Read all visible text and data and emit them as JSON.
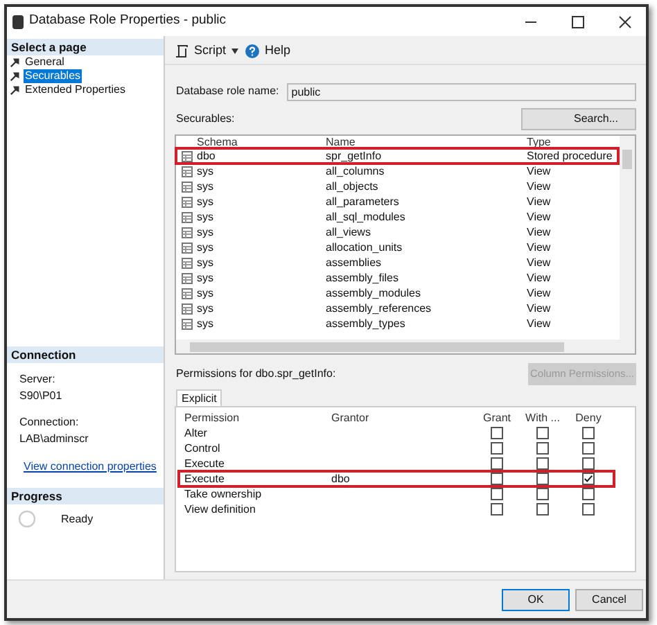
{
  "window": {
    "title": "Database Role Properties - public"
  },
  "select_page": {
    "title": "Select a page",
    "items": [
      {
        "label": "General",
        "selected": false
      },
      {
        "label": "Securables",
        "selected": true
      },
      {
        "label": "Extended Properties",
        "selected": false
      }
    ]
  },
  "toolbar": {
    "script": "Script",
    "help": "Help"
  },
  "role_name": {
    "label": "Database role name:",
    "value": "public"
  },
  "securables": {
    "label": "Securables:",
    "search": "Search...",
    "columns": [
      "Schema",
      "Name",
      "Type"
    ],
    "rows": [
      {
        "schema": "dbo",
        "name": "spr_getInfo",
        "type": "Stored procedure",
        "highlighted": true
      },
      {
        "schema": "sys",
        "name": "all_columns",
        "type": "View",
        "highlighted": false
      },
      {
        "schema": "sys",
        "name": "all_objects",
        "type": "View",
        "highlighted": false
      },
      {
        "schema": "sys",
        "name": "all_parameters",
        "type": "View",
        "highlighted": false
      },
      {
        "schema": "sys",
        "name": "all_sql_modules",
        "type": "View",
        "highlighted": false
      },
      {
        "schema": "sys",
        "name": "all_views",
        "type": "View",
        "highlighted": false
      },
      {
        "schema": "sys",
        "name": "allocation_units",
        "type": "View",
        "highlighted": false
      },
      {
        "schema": "sys",
        "name": "assemblies",
        "type": "View",
        "highlighted": false
      },
      {
        "schema": "sys",
        "name": "assembly_files",
        "type": "View",
        "highlighted": false
      },
      {
        "schema": "sys",
        "name": "assembly_modules",
        "type": "View",
        "highlighted": false
      },
      {
        "schema": "sys",
        "name": "assembly_references",
        "type": "View",
        "highlighted": false
      },
      {
        "schema": "sys",
        "name": "assembly_types",
        "type": "View",
        "highlighted": false
      }
    ]
  },
  "connection": {
    "title": "Connection",
    "server_label": "Server:",
    "server": "S90\\P01",
    "connection_label": "Connection:",
    "connection": "LAB\\adminscr",
    "link": "View connection properties"
  },
  "progress": {
    "title": "Progress",
    "status": "Ready"
  },
  "permissions": {
    "label": "Permissions for dbo.spr_getInfo:",
    "column_permissions": {
      "label": "Column Permissions...",
      "disabled": true
    },
    "tab": "Explicit",
    "columns": [
      "Permission",
      "Grantor",
      "Grant",
      "With ...",
      "Deny"
    ],
    "rows": [
      {
        "permission": "Alter",
        "grant": false,
        "with_grant": false,
        "deny": false,
        "highlighted": false
      },
      {
        "permission": "Control",
        "grant": false,
        "with_grant": false,
        "deny": false,
        "highlighted": false
      },
      {
        "permission": "Execute",
        "grant": false,
        "with_grant": false,
        "deny": false,
        "highlighted": false
      },
      {
        "permission": "Execute",
        "grantor": "dbo",
        "grant": false,
        "with_grant": false,
        "deny": true,
        "highlighted": true
      },
      {
        "permission": "Take ownership",
        "grant": false,
        "with_grant": false,
        "deny": false,
        "highlighted": false
      },
      {
        "permission": "View definition",
        "grant": false,
        "with_grant": false,
        "deny": false,
        "highlighted": false
      }
    ]
  },
  "buttons": [
    "OK",
    "Cancel"
  ]
}
